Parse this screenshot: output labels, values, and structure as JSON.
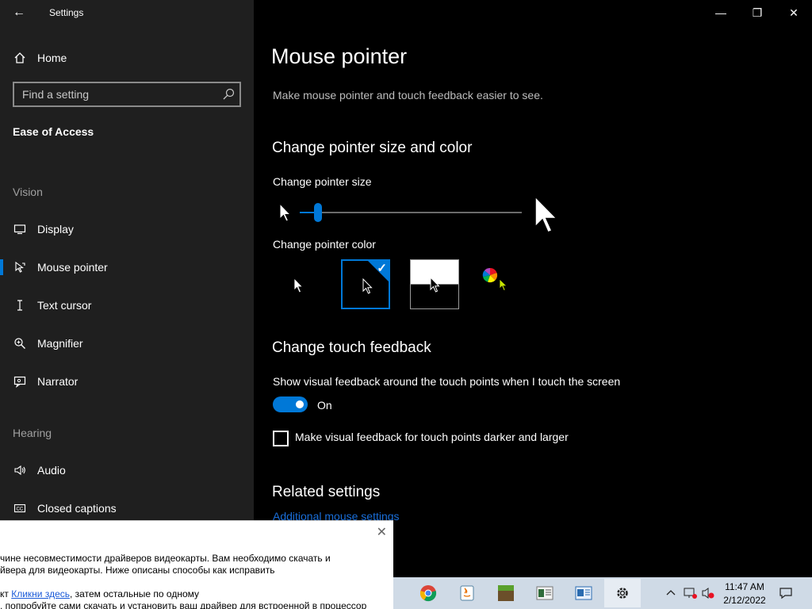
{
  "app": {
    "title": "Settings",
    "back_glyph": "←"
  },
  "window": {
    "minimize": "—",
    "restore": "❐",
    "close": "✕"
  },
  "sidebar": {
    "home": {
      "label": "Home",
      "icon": "home-icon"
    },
    "search": {
      "placeholder": "Find a setting"
    },
    "category": "Ease of Access",
    "vision_heading": "Vision",
    "vision_items": [
      {
        "label": "Display",
        "icon": "monitor-icon"
      },
      {
        "label": "Mouse pointer",
        "icon": "pointer-icon",
        "active": true
      },
      {
        "label": "Text cursor",
        "icon": "text-cursor-icon"
      },
      {
        "label": "Magnifier",
        "icon": "magnifier-icon"
      },
      {
        "label": "Narrator",
        "icon": "narrator-icon"
      }
    ],
    "hearing_heading": "Hearing",
    "hearing_items": [
      {
        "label": "Audio",
        "icon": "speaker-icon"
      },
      {
        "label": "Closed captions",
        "icon": "cc-icon"
      }
    ]
  },
  "main": {
    "title": "Mouse pointer",
    "description": "Make mouse pointer and touch feedback easier to see.",
    "section_pointer": "Change pointer size and color",
    "size_label": "Change pointer size",
    "size_value": 1,
    "size_max": 15,
    "color_label": "Change pointer color",
    "color_options": [
      "white",
      "black",
      "inverted",
      "custom"
    ],
    "color_selected": "black",
    "section_touch": "Change touch feedback",
    "touch_label": "Show visual feedback around the touch points when I touch the screen",
    "touch_toggle": "On",
    "darker_label": "Make visual feedback for touch points darker and larger",
    "related_heading": "Related settings",
    "related_link": "Additional mouse settings"
  },
  "popup": {
    "lines": [
      "чине несовместимости драйверов видеокарты. Вам необходимо скачать и",
      "йвера для видеокарты. Ниже описаны способы как исправить",
      "",
      "кт ",
      ", попробуйте сами скачать и установить ваш драйвер для встроенной в процессор"
    ],
    "link_text": "Кликни здесь",
    "after_link": ", затем остальные по одному",
    "close": "✕"
  },
  "taskbar": {
    "apps": [
      "chrome-icon",
      "java-icon",
      "minecraft-icon",
      "app-icon",
      "app2-icon",
      "settings-icon"
    ],
    "time": "11:47 AM",
    "date": "2/12/2022"
  },
  "colors": {
    "accent": "#0078d7",
    "sidebar": "#1f1f1f",
    "background": "#000000"
  }
}
